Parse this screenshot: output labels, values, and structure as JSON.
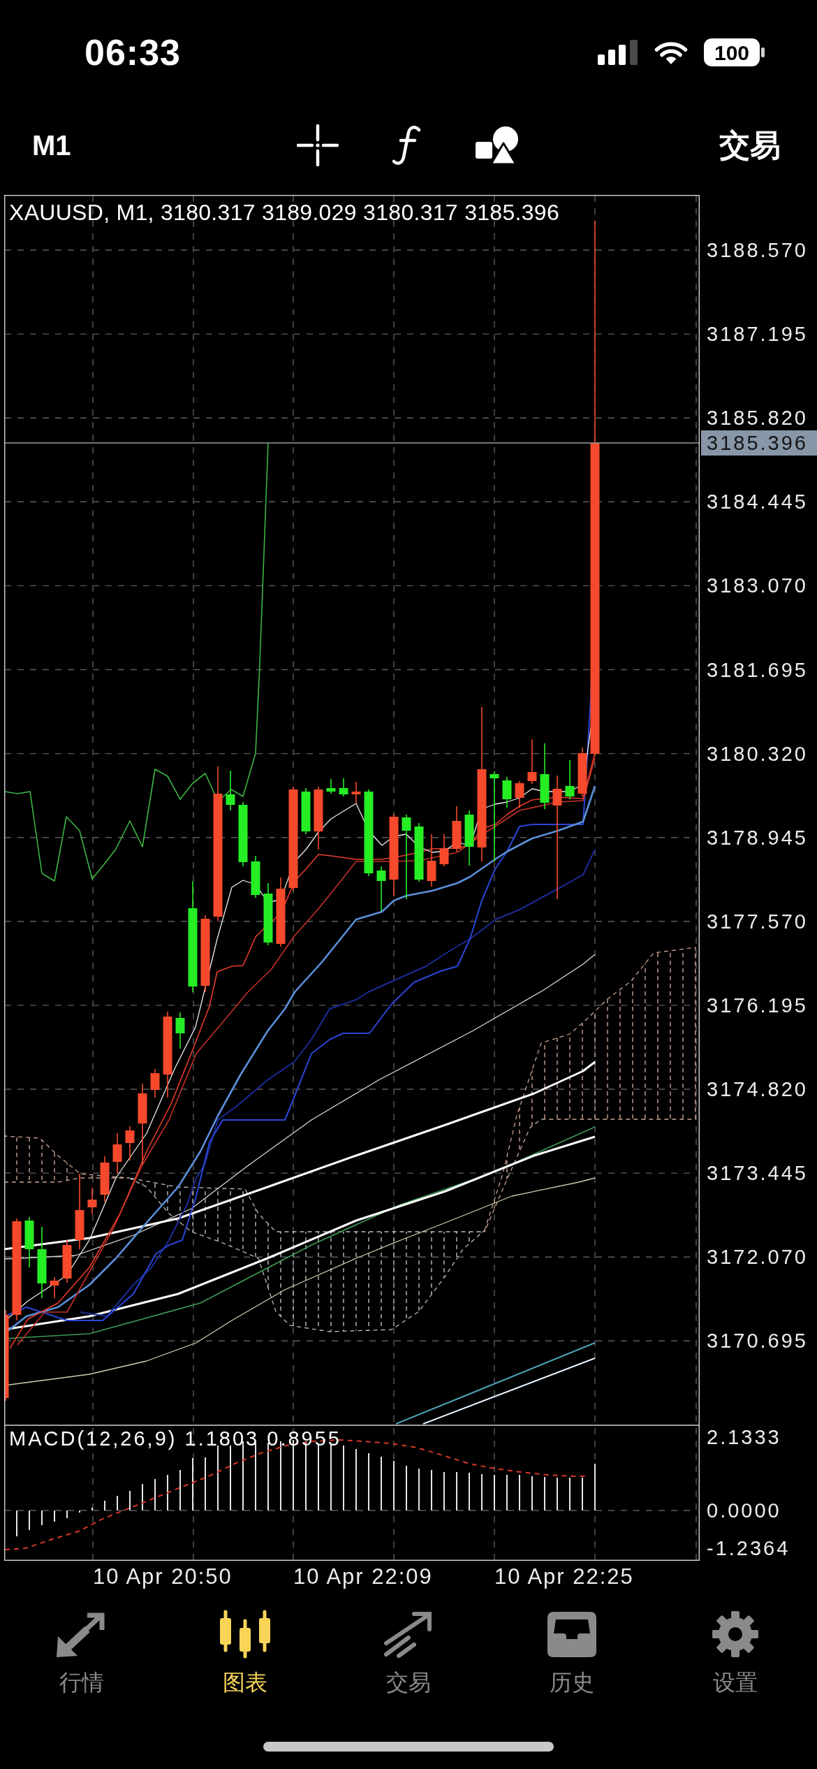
{
  "status_bar": {
    "time": "06:33",
    "battery": "100"
  },
  "toolbar": {
    "timeframe": "M1",
    "trade_button": "交易"
  },
  "chart": {
    "header": "XAUUSD, M1, 3180.317 3189.029 3180.317 3185.396",
    "price_labels": [
      "3188.570",
      "3187.195",
      "3185.820",
      "3184.445",
      "3183.070",
      "3181.695",
      "3180.320",
      "3178.945",
      "3177.570",
      "3176.195",
      "3174.820",
      "3173.445",
      "3172.070",
      "3170.695"
    ],
    "current_price": "3185.396",
    "time_labels": [
      "10 Apr 20:50",
      "10 Apr 22:09",
      "10 Apr 22:25"
    ]
  },
  "macd": {
    "label": "MACD(12,26,9) 1.1803 0.8955",
    "scale_labels": [
      "2.1333",
      "0.0000",
      "-1.2364"
    ]
  },
  "tab_bar": {
    "tabs": [
      {
        "label": "行情",
        "selected": false
      },
      {
        "label": "图表",
        "selected": true
      },
      {
        "label": "交易",
        "selected": false
      },
      {
        "label": "历史",
        "selected": false
      },
      {
        "label": "设置",
        "selected": false
      }
    ]
  }
}
